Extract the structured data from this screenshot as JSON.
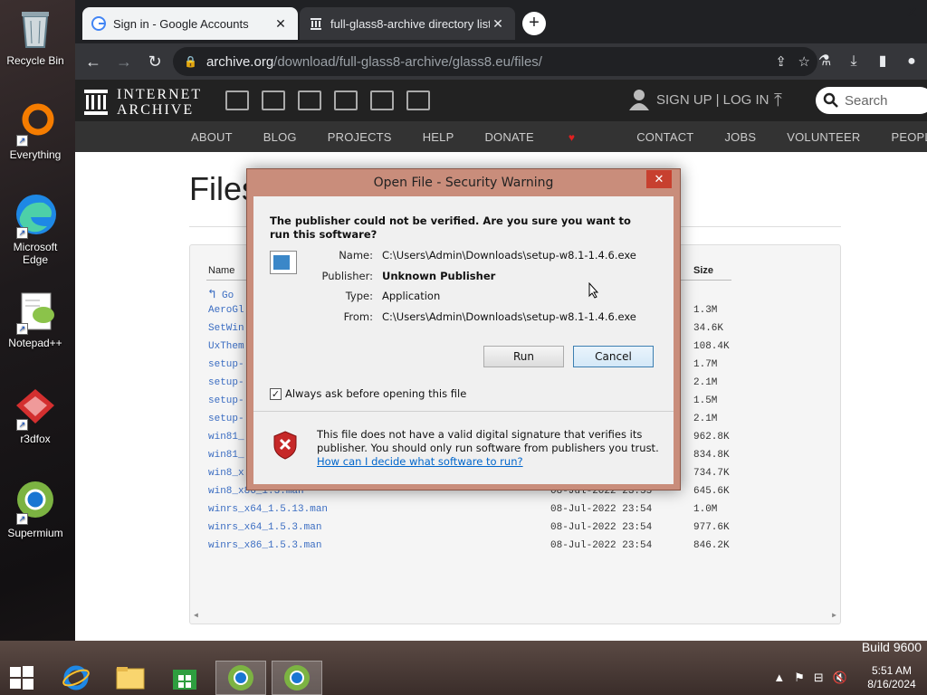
{
  "desktop": {
    "icons": [
      {
        "label": "Recycle Bin",
        "icon": "recycle-bin-icon"
      },
      {
        "label": "Everything",
        "icon": "everything-icon"
      },
      {
        "label": "Microsoft Edge",
        "icon": "edge-icon"
      },
      {
        "label": "Notepad++",
        "icon": "notepad-plus-plus-icon"
      },
      {
        "label": "r3dfox",
        "icon": "r3dfox-icon"
      },
      {
        "label": "Supermium",
        "icon": "supermium-icon"
      }
    ]
  },
  "browser": {
    "tabs": [
      {
        "title": "Sign in - Google Accounts",
        "icon": "google-icon",
        "active": false
      },
      {
        "title": "full-glass8-archive directory listi",
        "icon": "archive-icon",
        "active": true
      }
    ],
    "new_tab": "+",
    "address": {
      "host": "archive.org",
      "path": "/download/full-glass8-archive/glass8.eu/files/"
    }
  },
  "site": {
    "logo_line1": "INTERNET",
    "logo_line2": "ARCHIVE",
    "user_links": "SIGN UP | LOG IN",
    "search_placeholder": "Search",
    "nav": [
      "ABOUT",
      "BLOG",
      "PROJECTS",
      "HELP",
      "DONATE",
      "CONTACT",
      "JOBS",
      "VOLUNTEER",
      "PEOPLE"
    ],
    "page_title": "Files",
    "columns": {
      "name": "Name",
      "size": "Size"
    },
    "go_up": "Go",
    "rows": [
      {
        "name": "AeroGl",
        "date": "",
        "size": "1.3M"
      },
      {
        "name": "SetWin",
        "date": "",
        "size": "34.6K"
      },
      {
        "name": "UxThem",
        "date": "",
        "size": "108.4K"
      },
      {
        "name": "setup-",
        "date": "",
        "size": "1.7M"
      },
      {
        "name": "setup-",
        "date": "",
        "size": "2.1M"
      },
      {
        "name": "setup-",
        "date": "",
        "size": "1.5M"
      },
      {
        "name": "setup-",
        "date": "",
        "size": "2.1M"
      },
      {
        "name": "win81_",
        "date": "",
        "size": "962.8K"
      },
      {
        "name": "win81_",
        "date": "",
        "size": "834.8K"
      },
      {
        "name": "win8_x",
        "date": "",
        "size": "734.7K"
      },
      {
        "name": "win8_x86_1.3.man",
        "date": "08-Jul-2022 23:55",
        "size": "645.6K"
      },
      {
        "name": "winrs_x64_1.5.13.man",
        "date": "08-Jul-2022 23:54",
        "size": "1.0M"
      },
      {
        "name": "winrs_x64_1.5.3.man",
        "date": "08-Jul-2022 23:54",
        "size": "977.6K"
      },
      {
        "name": "winrs_x86_1.5.3.man",
        "date": "08-Jul-2022 23:54",
        "size": "846.2K"
      }
    ]
  },
  "dialog": {
    "title": "Open File - Security Warning",
    "question": "The publisher could not be verified.  Are you sure you want to run this software?",
    "fields": [
      {
        "key": "Name:",
        "value": "C:\\Users\\Admin\\Downloads\\setup-w8.1-1.4.6.exe",
        "bold": false
      },
      {
        "key": "Publisher:",
        "value": "Unknown Publisher",
        "bold": true
      },
      {
        "key": "Type:",
        "value": "Application",
        "bold": false
      },
      {
        "key": "From:",
        "value": "C:\\Users\\Admin\\Downloads\\setup-w8.1-1.4.6.exe",
        "bold": false
      }
    ],
    "run_label": "Run",
    "cancel_label": "Cancel",
    "checkbox_label": "Always ask before opening this file",
    "checkbox_checked": true,
    "warning_text": "This file does not have a valid digital signature that verifies its publisher.  You should only run software from publishers you trust.",
    "help_link": "How can I decide what software to run?"
  },
  "taskbar": {
    "build": "Build 9600",
    "time": "5:51 AM",
    "date": "8/16/2024"
  }
}
